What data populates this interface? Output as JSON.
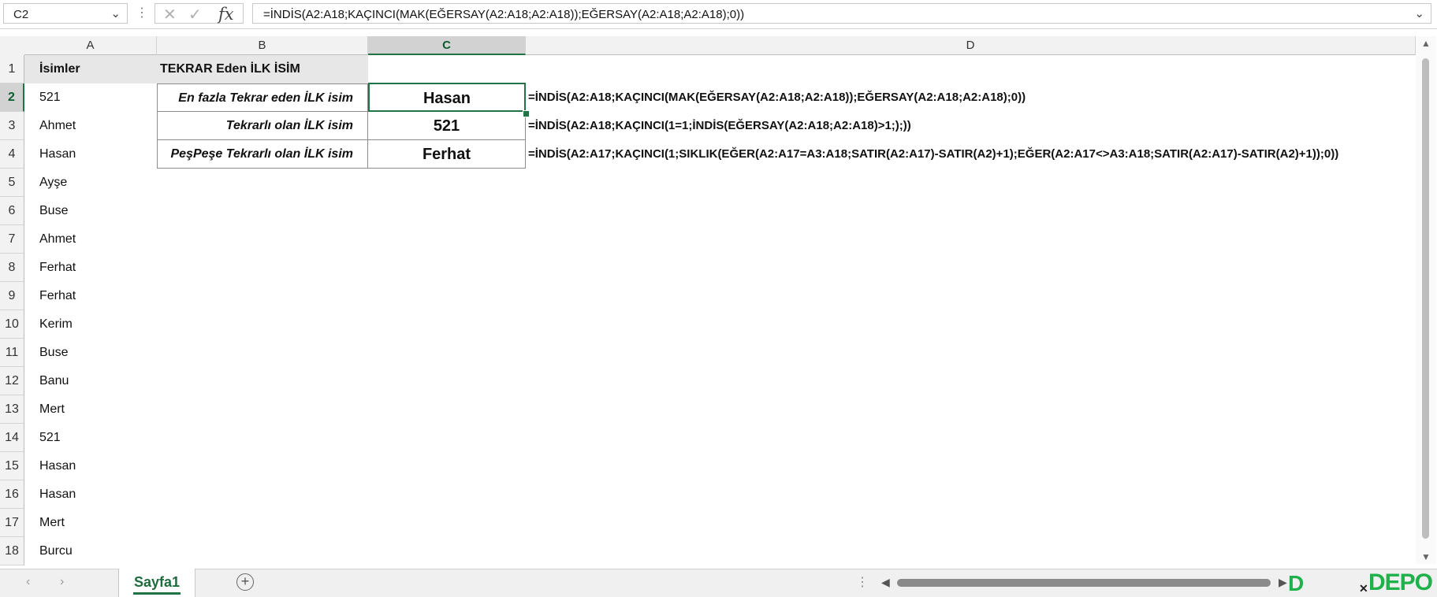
{
  "formula_bar": {
    "name_box": "C2",
    "formula": "=İNDİS(A2:A18;KAÇINCI(MAK(EĞERSAY(A2:A18;A2:A18));EĞERSAY(A2:A18;A2:A18);0))",
    "fx_label": "fx"
  },
  "columns": [
    {
      "letter": "A"
    },
    {
      "letter": "B"
    },
    {
      "letter": "C",
      "selected": true
    },
    {
      "letter": "D"
    }
  ],
  "rows": [
    "1",
    "2",
    "3",
    "4",
    "5",
    "6",
    "7",
    "8",
    "9",
    "10",
    "11",
    "12",
    "13",
    "14",
    "15",
    "16",
    "17",
    "18"
  ],
  "sheet": {
    "A1": "İsimler",
    "B1": "TEKRAR Eden İLK İSİM",
    "names": [
      "521",
      "Ahmet",
      "Hasan",
      "Ayşe",
      "Buse",
      "Ahmet",
      "Ferhat",
      "Ferhat",
      "Kerim",
      "Buse",
      "Banu",
      "Mert",
      "521",
      "Hasan",
      "Hasan",
      "Mert",
      "Burcu"
    ],
    "results": [
      {
        "label": "En fazla Tekrar eden İLK isim",
        "value": "Hasan",
        "formula": "=İNDİS(A2:A18;KAÇINCI(MAK(EĞERSAY(A2:A18;A2:A18));EĞERSAY(A2:A18;A2:A18);0))"
      },
      {
        "label": "Tekrarlı olan İLK isim",
        "value": "521",
        "formula": "=İNDİS(A2:A18;KAÇINCI(1=1;İNDİS(EĞERSAY(A2:A18;A2:A18)>1;);))"
      },
      {
        "label": "PeşPeşe Tekrarlı olan İLK isim",
        "value": "Ferhat",
        "formula": "=İNDİS(A2:A17;KAÇINCI(1;SIKLIK(EĞER(A2:A17=A3:A18;SATIR(A2:A17)-SATIR(A2)+1);EĞER(A2:A17<>A3:A18;SATIR(A2:A17)-SATIR(A2)+1));0))"
      }
    ]
  },
  "tabs": {
    "sheet_name": "Sayfa1",
    "add_symbol": "+"
  },
  "watermark": {
    "mark": "D",
    "x_symbol": "✕",
    "brand": "DEPO"
  },
  "colors": {
    "accent": "#217346",
    "header_bg": "#f2f2f2",
    "label_bg": "#e7e7e7",
    "logo_green": "#1fb14b"
  }
}
